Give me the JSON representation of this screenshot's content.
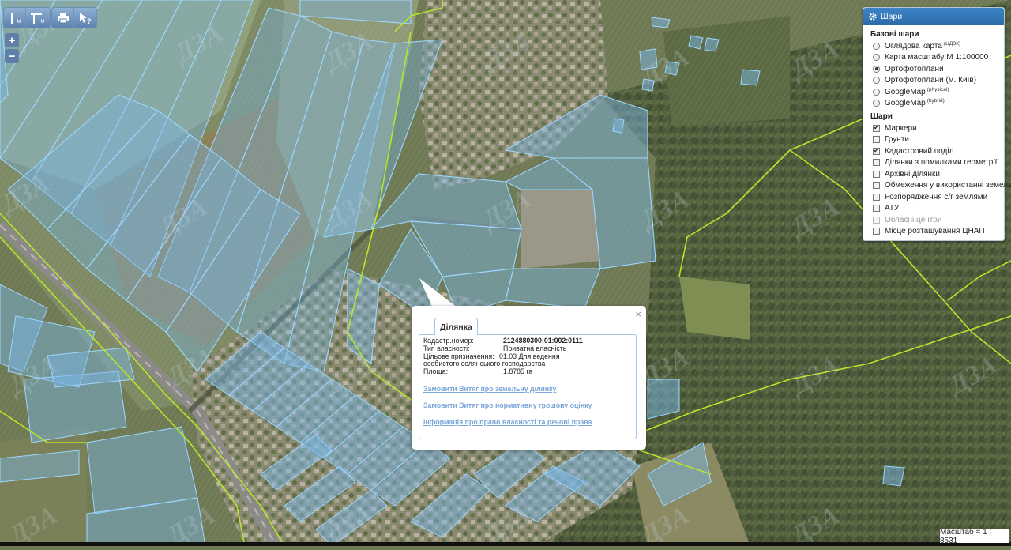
{
  "toolbar": {
    "tool1_label": "M",
    "tool2_label": "M"
  },
  "zoom": {
    "in_label": "+",
    "out_label": "−"
  },
  "layers_panel": {
    "title": "Шари",
    "base_header": "Базові шари",
    "base_layers": [
      {
        "label": "Оглядова карта",
        "sup": "(ЦДЗК)",
        "selected": false
      },
      {
        "label": "Карта масштабу М 1:100000",
        "sup": "",
        "selected": false
      },
      {
        "label": "Ортофотоплани",
        "sup": "",
        "selected": true
      },
      {
        "label": "Ортофотоплани (м. Київ)",
        "sup": "",
        "selected": false
      },
      {
        "label": "GoogleMap",
        "sup": "(physical)",
        "selected": false
      },
      {
        "label": "GoogleMap",
        "sup": "(hybrid)",
        "selected": false
      }
    ],
    "overlay_header": "Шари",
    "overlays": [
      {
        "label": "Маркери",
        "checked": true,
        "disabled": false
      },
      {
        "label": "Грунти",
        "checked": false,
        "disabled": false
      },
      {
        "label": "Кадастровий поділ",
        "checked": true,
        "disabled": false
      },
      {
        "label": "Ділянки з помилками геометрії",
        "checked": false,
        "disabled": false
      },
      {
        "label": "Архівні ділянки",
        "checked": false,
        "disabled": false
      },
      {
        "label": "Обмеження у використанні земель",
        "checked": false,
        "disabled": false
      },
      {
        "label": "Розпорядження с/г землями",
        "checked": false,
        "disabled": false
      },
      {
        "label": "АТУ",
        "checked": false,
        "disabled": false
      },
      {
        "label": "Обласні центри",
        "checked": false,
        "disabled": true
      },
      {
        "label": "Місце розташування ЦНАП",
        "checked": false,
        "disabled": false
      }
    ]
  },
  "popup": {
    "tab_label": "Ділянка",
    "close_glyph": "×",
    "fields": {
      "cadastral_label": "Кадастр.номер:",
      "cadastral_value": "2124880300:01:002:0111",
      "ownership_label": "Тип власності:",
      "ownership_value": "Приватна власність",
      "purpose_label": "Цільове призначення:",
      "purpose_value": "01.03 Для ведення особистого селянського господарства",
      "area_label": "Площа:",
      "area_value": "1.8785 га"
    },
    "links": [
      "Замовити Витяг про земельну ділянку",
      "Замовити Витяг про нормативну грошову оцінку",
      "Інформація про право власності та речові права"
    ]
  },
  "scale": {
    "text": "Масштаб = 1 : 8531"
  },
  "watermark": "ДЗА",
  "colors": {
    "parcel_stroke": "#9dd7ff",
    "parcel_fill": "#79b6e6",
    "boundary": "#b9e62a",
    "panel_header": "#3173b5",
    "link": "#7aa6d8"
  }
}
